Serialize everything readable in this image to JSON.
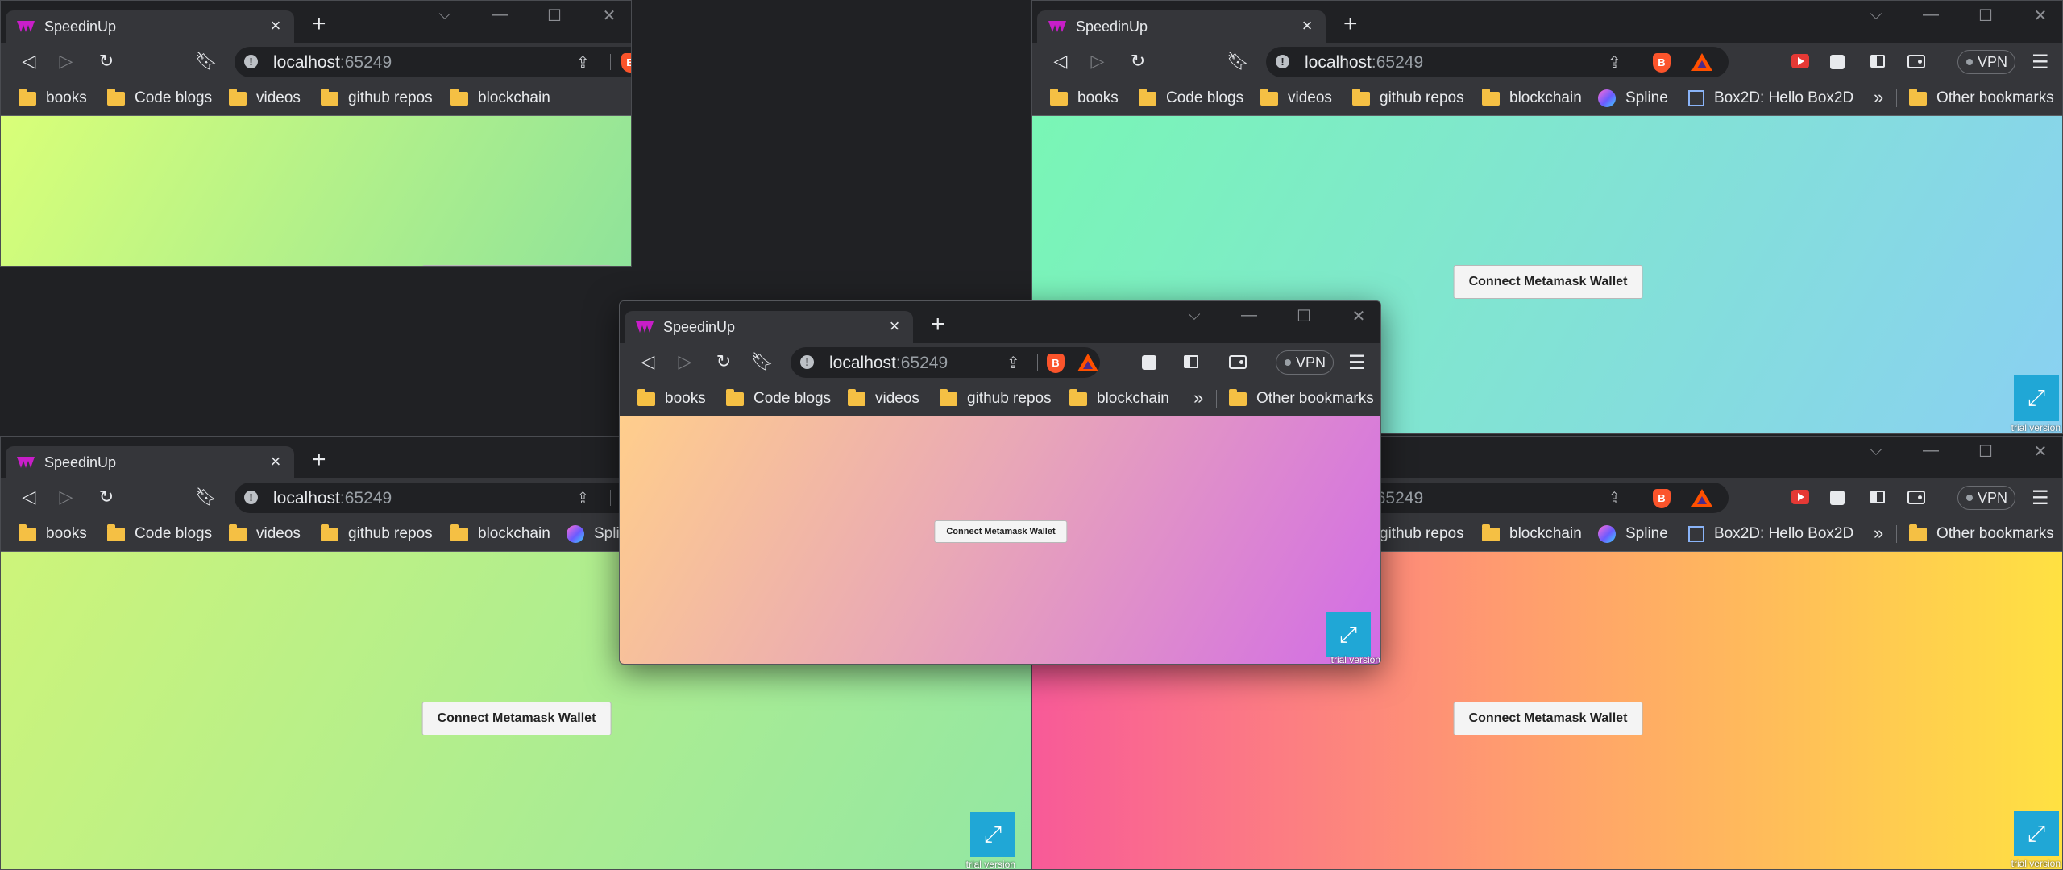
{
  "tab": {
    "title": "SpeedinUp",
    "close": "×",
    "new": "+"
  },
  "window_controls": {
    "chevron": "⌵",
    "minimize": "—",
    "maximize": "☐",
    "close": "✕"
  },
  "address": {
    "host": "localhost",
    "port": ":65249"
  },
  "vpn_label": "VPN",
  "bookmarks": {
    "books": "books",
    "code_blogs": "Code blogs",
    "videos": "videos",
    "github": "github repos",
    "blockchain": "blockchain",
    "spline": "Spline",
    "box2d": "Box2D: Hello Box2D",
    "more": "»",
    "other": "Other bookmarks"
  },
  "page": {
    "connect_label": "Connect Metamask Wallet",
    "trial_label": "trial version",
    "expand_icon": "⤢"
  },
  "backgrounds": {
    "top_left": [
      "#d9ff78",
      "#8fe39a"
    ],
    "top_right": [
      "#79f6b5",
      "#8ad0f2"
    ],
    "bottom_left": [
      "#cdf47a",
      "#93e7a3"
    ],
    "bottom_right": [
      "#f85a98",
      "#ffe142"
    ],
    "front": [
      "#ffce8c",
      "#d26ce6"
    ]
  },
  "icons": [
    "back-icon",
    "forward-icon",
    "reload-icon",
    "bookmark-icon",
    "info-icon",
    "share-icon",
    "brave-shield-icon",
    "bat-rewards-icon",
    "youtube-extension-icon",
    "extensions-icon",
    "sidebar-icon",
    "wallet-icon",
    "menu-icon",
    "folder-icon",
    "spline-icon",
    "box2d-icon",
    "expand-icon"
  ]
}
